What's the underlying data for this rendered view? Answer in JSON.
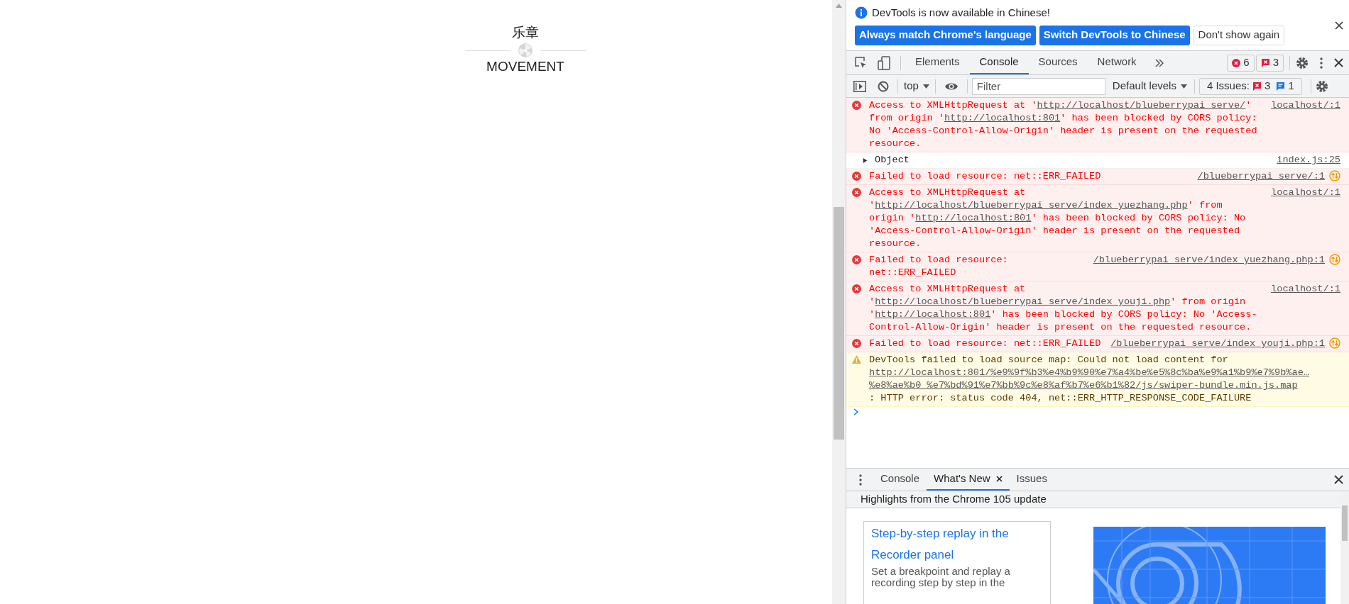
{
  "page": {
    "title_zh": "乐章",
    "title_en": "MOVEMENT"
  },
  "infobar": {
    "message": "DevTools is now available in Chinese!",
    "buttons": [
      {
        "label": "Always match Chrome's language",
        "primary": true
      },
      {
        "label": "Switch DevTools to Chinese",
        "primary": true
      },
      {
        "label": "Don't show again",
        "primary": false
      }
    ]
  },
  "main_tabs": [
    {
      "label": "Elements",
      "selected": false
    },
    {
      "label": "Console",
      "selected": true
    },
    {
      "label": "Sources",
      "selected": false
    },
    {
      "label": "Network",
      "selected": false
    }
  ],
  "counters": {
    "errors": "6",
    "issues": "3"
  },
  "console_toolbar": {
    "context": "top",
    "filter_placeholder": "Filter",
    "levels": "Default levels",
    "issues_label": "4 Issues:",
    "issues_errors": "3",
    "issues_info": "1"
  },
  "messages": [
    {
      "kind": "error",
      "source": "localhost/:1",
      "network": false,
      "parts": [
        {
          "text": "Access to XMLHttpRequest at '",
          "link": false
        },
        {
          "text": "http://localhost/blueberrypai_serve/",
          "link": true
        },
        {
          "text": "' from origin '",
          "link": false
        },
        {
          "text": "http://localhost:801",
          "link": true
        },
        {
          "text": "' has been blocked by CORS policy: No 'Access-Control-Allow-Origin' header is present on the requested resource.",
          "link": false
        }
      ]
    },
    {
      "kind": "object",
      "source": "index.js:25",
      "network": false,
      "expanded": false,
      "parts": [
        {
          "text": "Object",
          "link": false
        }
      ]
    },
    {
      "kind": "error",
      "source": "/blueberrypai_serve/:1",
      "network": true,
      "parts": [
        {
          "text": "Failed to load resource: net::ERR_FAILED",
          "link": false
        }
      ]
    },
    {
      "kind": "error",
      "source": "localhost/:1",
      "network": false,
      "parts": [
        {
          "text": "Access to XMLHttpRequest at '",
          "link": false
        },
        {
          "text": "http://localhost/blueberrypai_serve/index_yuezhang.php",
          "link": true
        },
        {
          "text": "' from origin '",
          "link": false
        },
        {
          "text": "http://localhost:801",
          "link": true
        },
        {
          "text": "' has been blocked by CORS policy: No 'Access-Control-Allow-Origin' header is present on the requested resource.",
          "link": false
        }
      ]
    },
    {
      "kind": "error",
      "source": "/blueberrypai_serve/index_yuezhang.php:1",
      "network": true,
      "parts": [
        {
          "text": "Failed to load resource: net::ERR_FAILED",
          "link": false
        }
      ]
    },
    {
      "kind": "error",
      "source": "localhost/:1",
      "network": false,
      "parts": [
        {
          "text": "Access to XMLHttpRequest at '",
          "link": false
        },
        {
          "text": "http://localhost/blueberrypai_serve/index_youji.php",
          "link": true
        },
        {
          "text": "' from origin '",
          "link": false
        },
        {
          "text": "http://localhost:801",
          "link": true
        },
        {
          "text": "' has been blocked by CORS policy: No 'Access-Control-Allow-Origin' header is present on the requested resource.",
          "link": false
        }
      ]
    },
    {
      "kind": "error",
      "source": "/blueberrypai_serve/index_youji.php:1",
      "network": true,
      "parts": [
        {
          "text": "Failed to load resource: net::ERR_FAILED",
          "link": false
        }
      ]
    },
    {
      "kind": "warning",
      "network": false,
      "parts": [
        {
          "text": "DevTools failed to load source map: Could not load content for ",
          "link": false
        },
        {
          "text": "http://localhost:801/%e9%9f%b3%e4%b9%90%e7%a4%be%e5%8c%ba%e9%a1%b9%e7%9b%ae…%e8%ae%b0_%e7%bd%91%e7%bb%9c%e8%af%b7%e6%b1%82/js/swiper-bundle.min.js.map",
          "link": true
        },
        {
          "text": ": HTTP error: status code 404, net::ERR_HTTP_RESPONSE_CODE_FAILURE",
          "link": false
        }
      ]
    }
  ],
  "drawer": {
    "tabs": [
      {
        "label": "Console",
        "selected": false,
        "closable": false
      },
      {
        "label": "What's New",
        "selected": true,
        "closable": true
      },
      {
        "label": "Issues",
        "selected": false,
        "closable": false
      }
    ],
    "header": "Highlights from the Chrome 105 update",
    "card": {
      "title": "Step-by-step replay in the Recorder panel",
      "description": "Set a breakpoint and replay a recording step by step in the"
    }
  }
}
